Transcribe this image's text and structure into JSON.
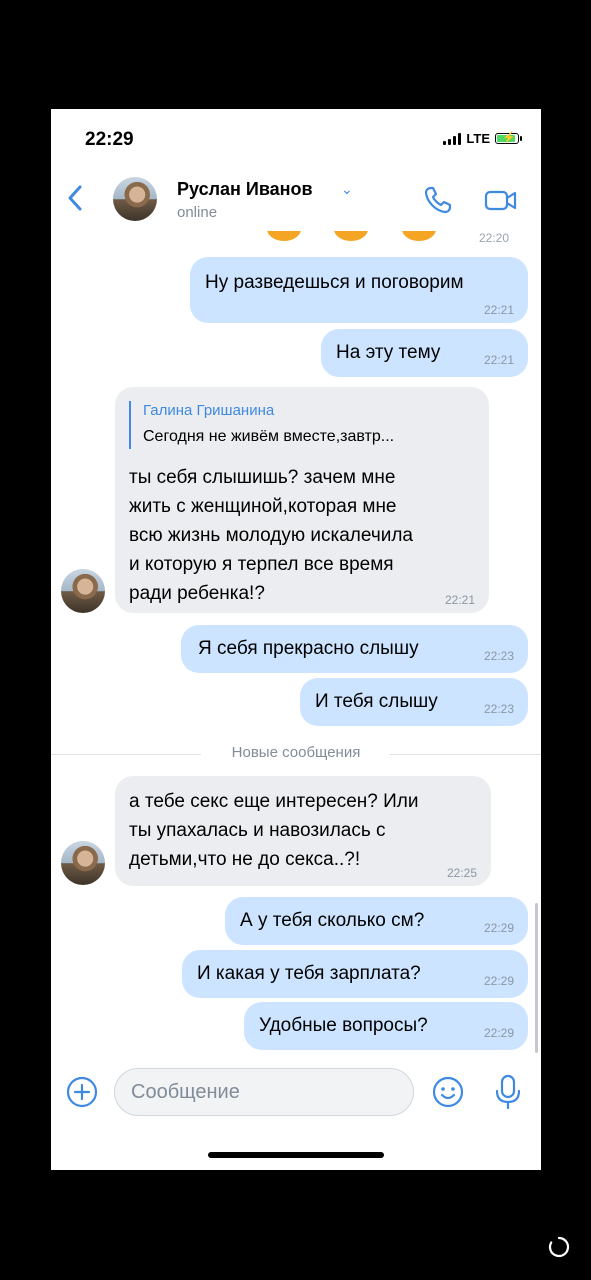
{
  "status_bar": {
    "time": "22:29",
    "network": "LTE"
  },
  "header": {
    "back_icon": "chevron-left-icon",
    "contact_name": "Руслан Иванов",
    "contact_status": "online",
    "call_icon": "phone-icon",
    "video_icon": "video-camera-icon"
  },
  "messages": {
    "top_time": "22:20",
    "m1": {
      "text": "Ну разведешься и поговорим",
      "time": "22:21"
    },
    "m2": {
      "text": "На эту тему",
      "time": "22:21"
    },
    "m3": {
      "quote_author": "Галина Гришанина",
      "quote_text": "Сегодня не живём вместе,завтр...",
      "line1": "ты себя слышишь? зачем мне",
      "line2": "жить с женщиной,которая мне",
      "line3": "всю жизнь молодую искалечила",
      "line4": "и которую я терпел все время",
      "line5": "ради ребенка!?",
      "time": "22:21"
    },
    "m4": {
      "text": "Я себя прекрасно слышу",
      "time": "22:23"
    },
    "m5": {
      "text": "И тебя слышу",
      "time": "22:23"
    },
    "divider": "Новые сообщения",
    "m6": {
      "line1": "а тебе секс еще интересен? Или",
      "line2": "ты упахалась и навозилась с",
      "line3": "детьми,что не до секса..?!",
      "time": "22:25"
    },
    "m7": {
      "text": "А у тебя сколько см?",
      "time": "22:29"
    },
    "m8": {
      "text": "И какая у тебя зарплата?",
      "time": "22:29"
    },
    "m9": {
      "text": "Удобные вопросы?",
      "time": "22:29"
    }
  },
  "composer": {
    "placeholder": "Сообщение",
    "attach_icon": "plus-circle-icon",
    "emoji_icon": "smile-icon",
    "mic_icon": "microphone-icon"
  },
  "colors": {
    "accent": "#3f8ae0",
    "outgoing": "#cce4ff",
    "incoming": "#ebedf0"
  }
}
